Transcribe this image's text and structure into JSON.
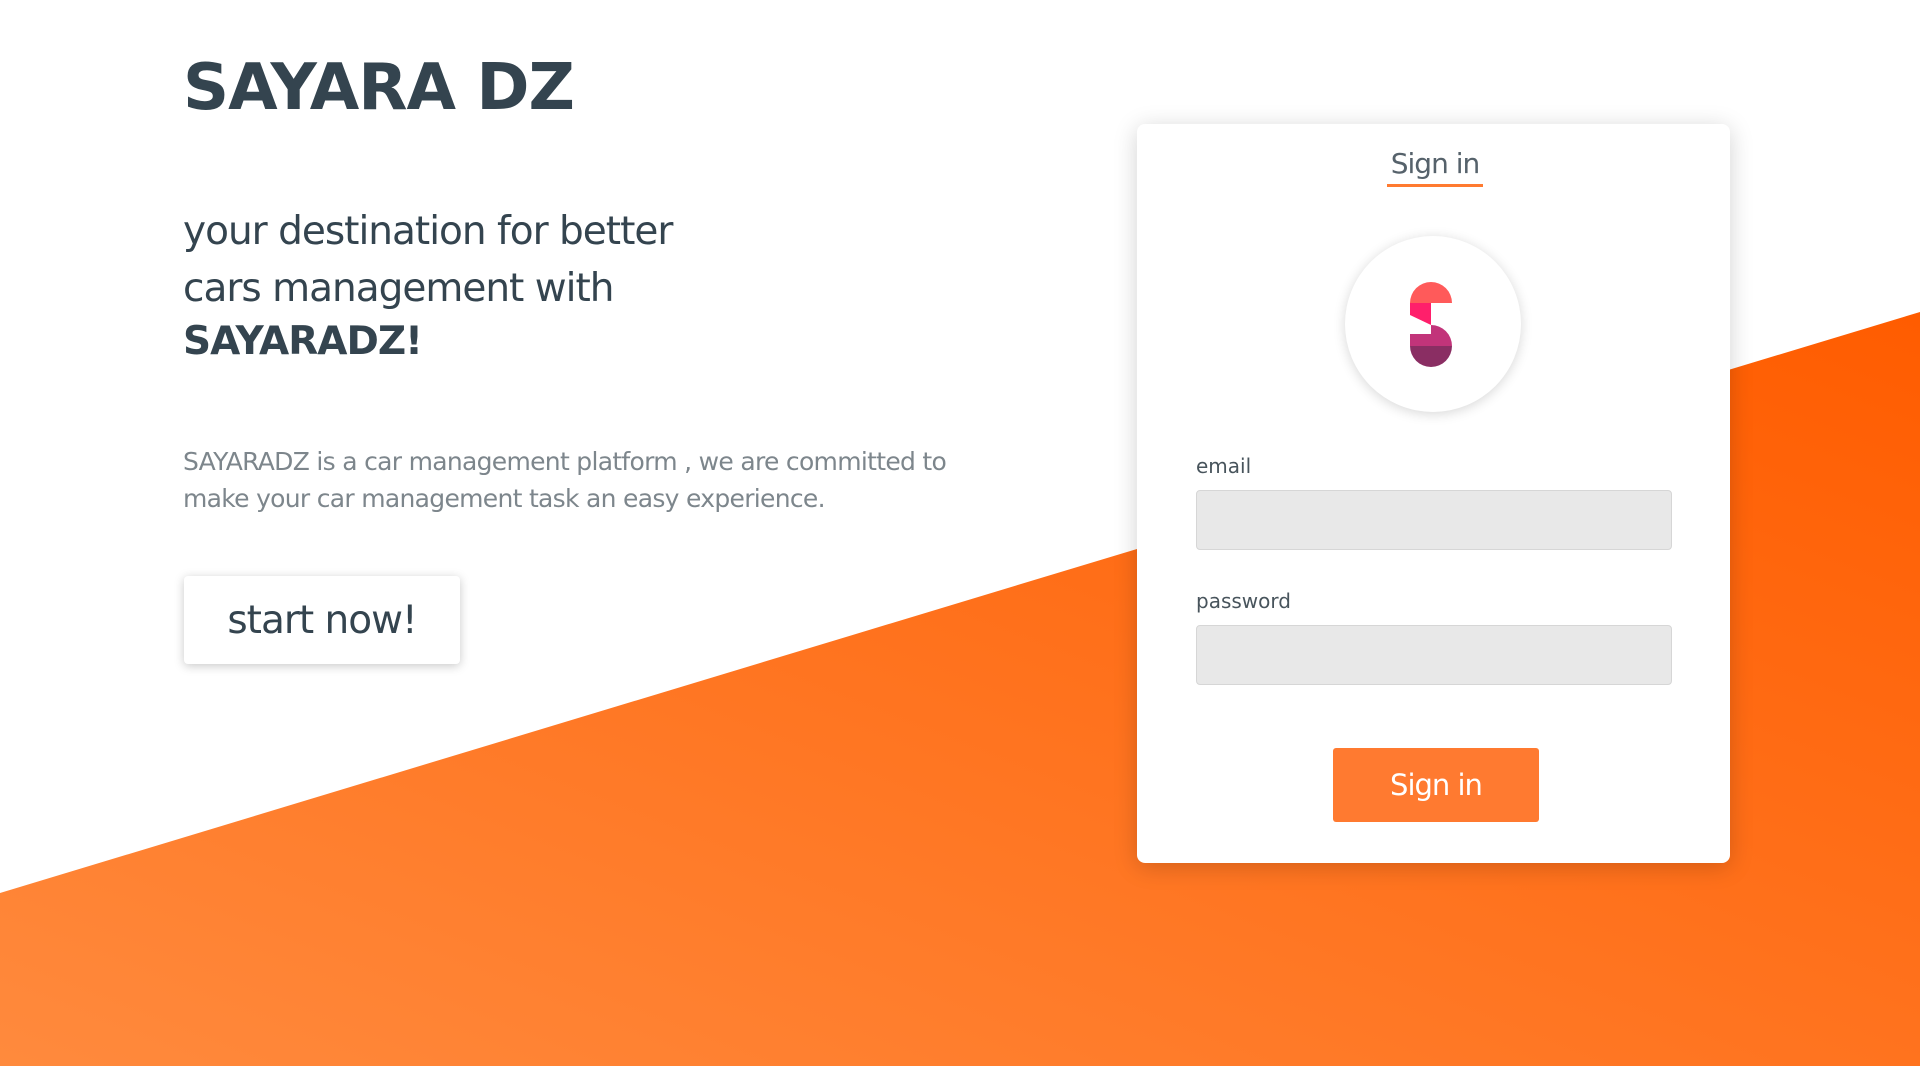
{
  "brand": {
    "title": "SAYARA DZ"
  },
  "hero": {
    "tagline_line1": "your destination for better",
    "tagline_line2": "cars management with",
    "tagline_strong": "SAYARADZ!",
    "description": "SAYARADZ is a car management platform , we are committed to make your car management task an easy experience.",
    "cta_label": "start now!"
  },
  "signin_card": {
    "tab_label": "Sign in",
    "logo_icon": "sayara-s-logo-icon",
    "email_label": "email",
    "email_value": "",
    "password_label": "password",
    "password_value": "",
    "submit_label": "Sign in"
  },
  "colors": {
    "accent": "#ff7a30",
    "accent_dark": "#ff5c00",
    "text_dark": "#34444f",
    "text_muted": "#7d868c",
    "input_bg": "#e8e8e8",
    "logo_top": "#ff5a5a",
    "logo_mid": "#ff1f6b",
    "logo_bottom": "#8a2e63"
  }
}
